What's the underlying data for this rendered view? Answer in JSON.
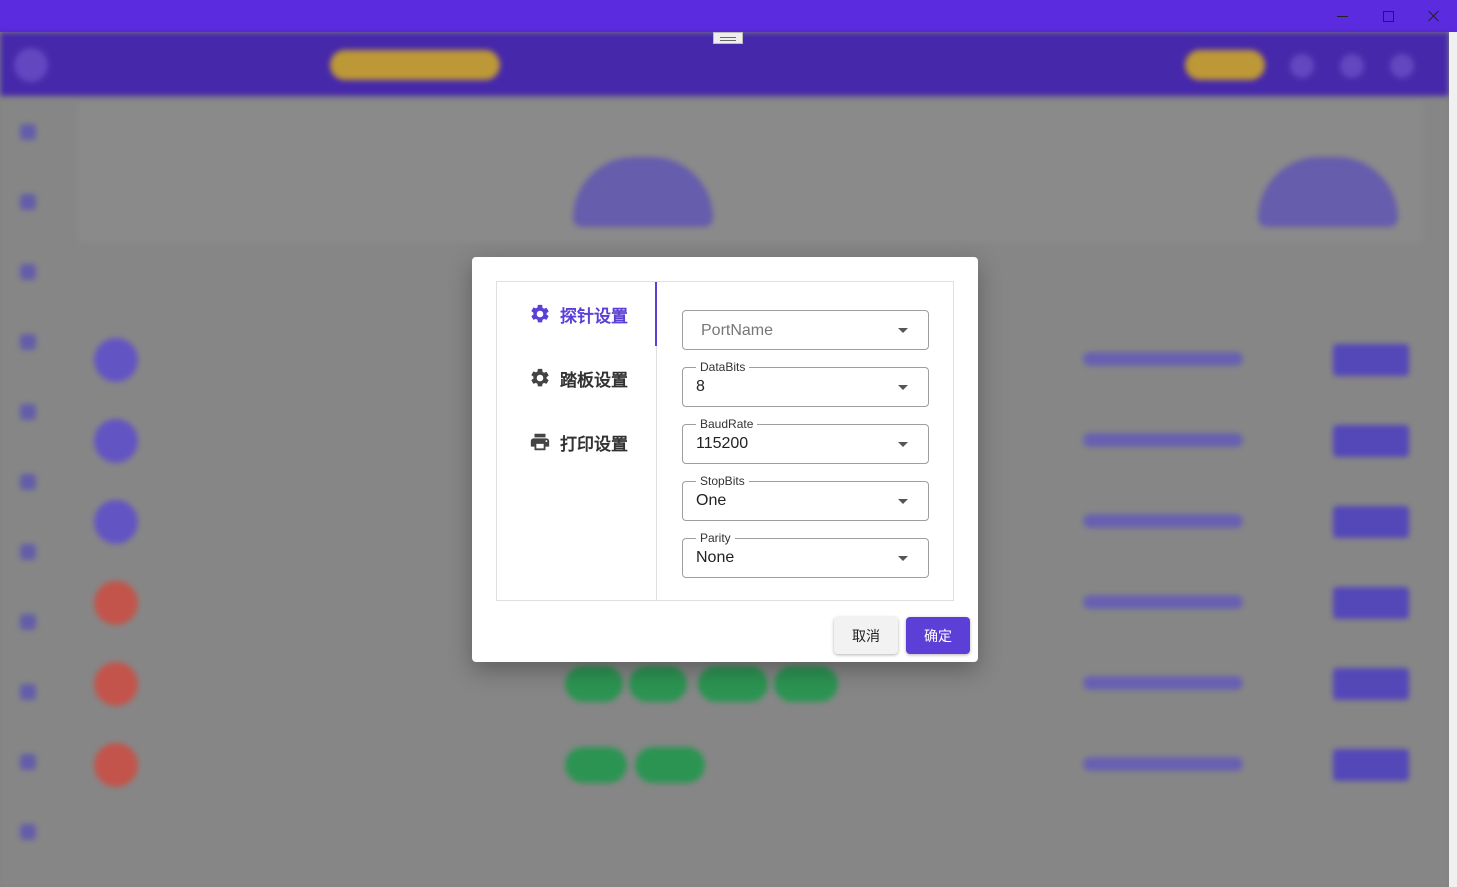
{
  "window": {
    "controls": [
      "minimize-icon",
      "maximize-icon",
      "close-icon"
    ]
  },
  "dialog": {
    "nav": [
      {
        "label": "探针设置",
        "icon": "gear-icon",
        "active": true
      },
      {
        "label": "踏板设置",
        "icon": "gear-icon",
        "active": false
      },
      {
        "label": "打印设置",
        "icon": "printer-icon",
        "active": false
      }
    ],
    "fields": {
      "port_name": {
        "placeholder": "PortName",
        "value": ""
      },
      "data_bits": {
        "label": "DataBits",
        "value": "8"
      },
      "baud_rate": {
        "label": "BaudRate",
        "value": "115200"
      },
      "stop_bits": {
        "label": "StopBits",
        "value": "One"
      },
      "parity": {
        "label": "Parity",
        "value": "None"
      }
    },
    "buttons": {
      "cancel": "取消",
      "ok": "确定"
    }
  },
  "colors": {
    "accent": "#5b3fd6",
    "titlebar": "#5b2be0"
  }
}
